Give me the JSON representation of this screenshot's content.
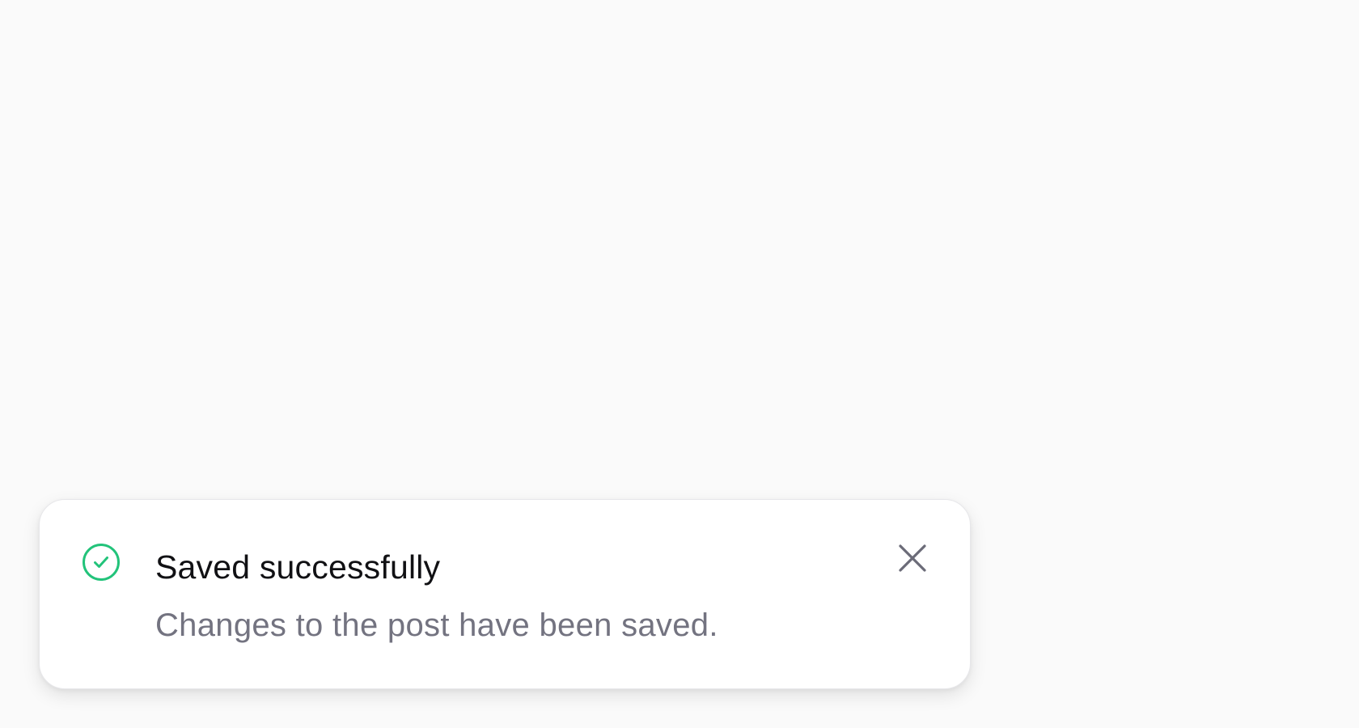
{
  "toast": {
    "status": "success",
    "icon": "check-circle-icon",
    "title": "Saved successfully",
    "message": "Changes to the post have been saved.",
    "close_icon": "close-icon",
    "colors": {
      "success": "#22c37a",
      "title": "#111114",
      "message": "#737380",
      "close": "#6b6b78",
      "background": "#fafafa",
      "card": "#ffffff"
    }
  }
}
